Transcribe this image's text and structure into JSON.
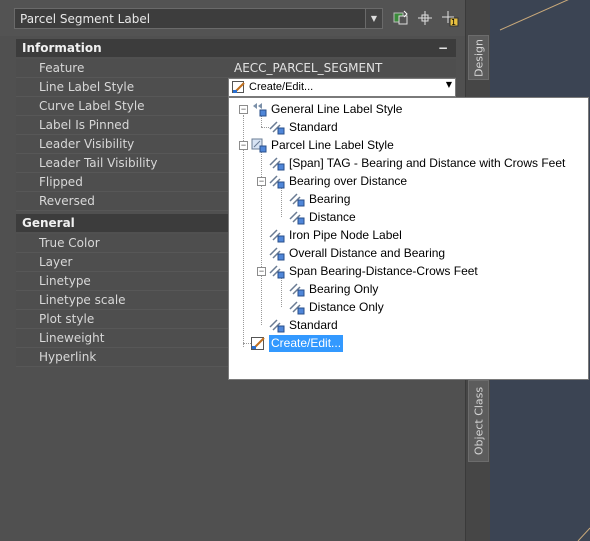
{
  "toolbar": {
    "object_select_value": "Parcel Segment Label",
    "buttons": [
      "quick-select-icon",
      "select-objects-icon",
      "toggle-pickadd-icon"
    ]
  },
  "sections": [
    {
      "title": "Information",
      "collapse_symbol": "−",
      "rows": [
        {
          "label": "Feature",
          "value": "AECC_PARCEL_SEGMENT"
        },
        {
          "label": "Line Label Style",
          "value": "Create/Edit..."
        },
        {
          "label": "Curve Label Style",
          "value": ""
        },
        {
          "label": "Label Is Pinned",
          "value": ""
        },
        {
          "label": "Leader Visibility",
          "value": ""
        },
        {
          "label": "Leader Tail Visibility",
          "value": ""
        },
        {
          "label": "Flipped",
          "value": ""
        },
        {
          "label": "Reversed",
          "value": ""
        }
      ]
    },
    {
      "title": "General",
      "collapse_symbol": "",
      "rows": [
        {
          "label": "True Color",
          "value": ""
        },
        {
          "label": "Layer",
          "value": ""
        },
        {
          "label": "Linetype",
          "value": ""
        },
        {
          "label": "Linetype scale",
          "value": ""
        },
        {
          "label": "Plot style",
          "value": ""
        },
        {
          "label": "Lineweight",
          "value": ""
        },
        {
          "label": "Hyperlink",
          "value": ""
        }
      ]
    }
  ],
  "side_tabs": {
    "design": "Design",
    "object_class": "Object Class"
  },
  "dropdown": {
    "items": [
      {
        "label": "General Line Label Style",
        "icon": "label-style-group-icon",
        "toggle": "−"
      },
      {
        "label": "Standard",
        "icon": "label-style-icon"
      },
      {
        "label": "Parcel Line Label Style",
        "icon": "parcel-label-style-group-icon",
        "toggle": "−"
      },
      {
        "label": "[Span] TAG - Bearing and Distance with Crows Feet",
        "icon": "label-style-icon"
      },
      {
        "label": "Bearing over Distance",
        "icon": "label-style-icon",
        "toggle": "−"
      },
      {
        "label": "Bearing",
        "icon": "child-label-style-icon"
      },
      {
        "label": "Distance",
        "icon": "child-label-style-icon"
      },
      {
        "label": "Iron Pipe Node Label",
        "icon": "label-style-icon"
      },
      {
        "label": "Overall Distance and Bearing",
        "icon": "label-style-icon"
      },
      {
        "label": "Span Bearing-Distance-Crows Feet",
        "icon": "label-style-icon",
        "toggle": "−"
      },
      {
        "label": "Bearing Only",
        "icon": "child-label-style-icon"
      },
      {
        "label": "Distance Only",
        "icon": "child-label-style-icon"
      },
      {
        "label": "Standard",
        "icon": "label-style-icon"
      },
      {
        "label": "Create/Edit...",
        "icon": "edit-style-icon",
        "selected": true
      }
    ]
  }
}
